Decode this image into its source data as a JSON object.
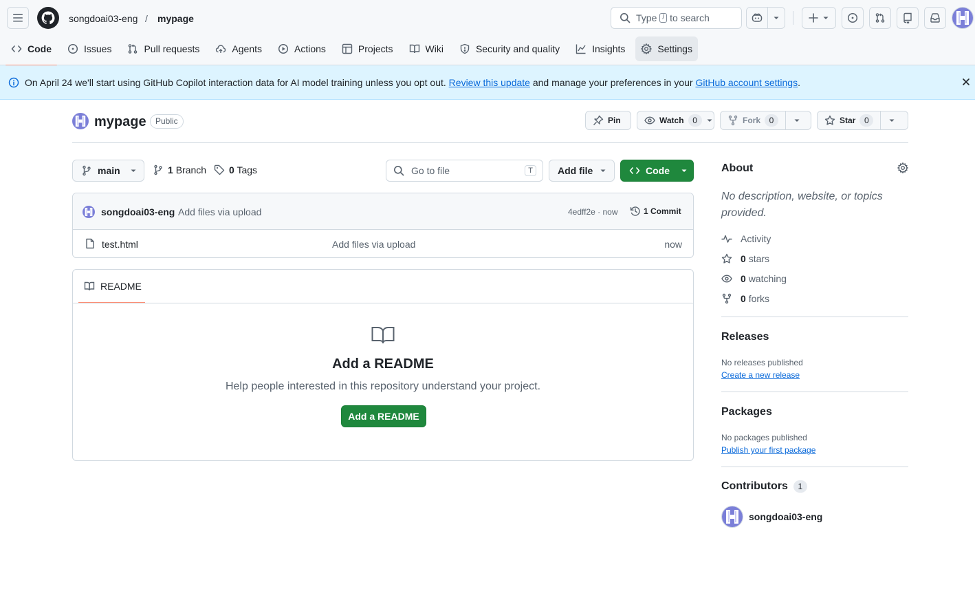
{
  "header": {
    "owner": "songdoai03-eng",
    "separator": "/",
    "repo": "mypage",
    "search_prefix": "Type",
    "search_key": "/",
    "search_suffix": "to search"
  },
  "tabs": [
    {
      "label": "Code",
      "icon": "code-icon",
      "selected": true
    },
    {
      "label": "Issues",
      "icon": "issue-icon"
    },
    {
      "label": "Pull requests",
      "icon": "pull-request-icon"
    },
    {
      "label": "Agents",
      "icon": "agents-icon"
    },
    {
      "label": "Actions",
      "icon": "play-icon"
    },
    {
      "label": "Projects",
      "icon": "table-icon"
    },
    {
      "label": "Wiki",
      "icon": "book-icon"
    },
    {
      "label": "Security and quality",
      "icon": "shield-icon"
    },
    {
      "label": "Insights",
      "icon": "graph-icon"
    },
    {
      "label": "Settings",
      "icon": "gear-icon"
    }
  ],
  "banner": {
    "text1": "On April 24 we'll start using GitHub Copilot interaction data for AI model training unless you opt out.",
    "link1": "Review this update",
    "text2": "and manage your preferences in your",
    "link2": "GitHub account settings",
    "text3": "."
  },
  "repo": {
    "name": "mypage",
    "visibility": "Public",
    "pin_label": "Pin",
    "watch_label": "Watch",
    "watch_count": "0",
    "fork_label": "Fork",
    "fork_count": "0",
    "star_label": "Star",
    "star_count": "0"
  },
  "filenav": {
    "branch": "main",
    "branch_count": "1",
    "branch_label": "Branch",
    "tag_count": "0",
    "tag_label": "Tags",
    "goto_placeholder": "Go to file",
    "goto_key": "T",
    "add_file": "Add file",
    "code": "Code"
  },
  "commit": {
    "author": "songdoai03-eng",
    "message": "Add files via upload",
    "meta": "4edff2e · now",
    "count": "1 Commit"
  },
  "files": [
    {
      "name": "test.html",
      "message": "Add files via upload",
      "time": "now"
    }
  ],
  "readme": {
    "tab": "README",
    "title": "Add a README",
    "description": "Help people interested in this repository understand your project.",
    "button": "Add a README"
  },
  "about": {
    "heading": "About",
    "description": "No description, website, or topics provided.",
    "activity": "Activity",
    "stars_count": "0",
    "stars_label": "stars",
    "watching_count": "0",
    "watching_label": "watching",
    "forks_count": "0",
    "forks_label": "forks"
  },
  "releases": {
    "heading": "Releases",
    "text": "No releases published",
    "link": "Create a new release"
  },
  "packages": {
    "heading": "Packages",
    "text": "No packages published",
    "link": "Publish your first package"
  },
  "contributors": {
    "heading": "Contributors",
    "count": "1",
    "name": "songdoai03-eng"
  },
  "colors": {
    "accent_green": "#1f883d",
    "link_blue": "#0969da",
    "tab_underline": "#fd8c73",
    "banner_bg": "#ddf4ff",
    "avatar_purple": "#7b7fd8"
  }
}
